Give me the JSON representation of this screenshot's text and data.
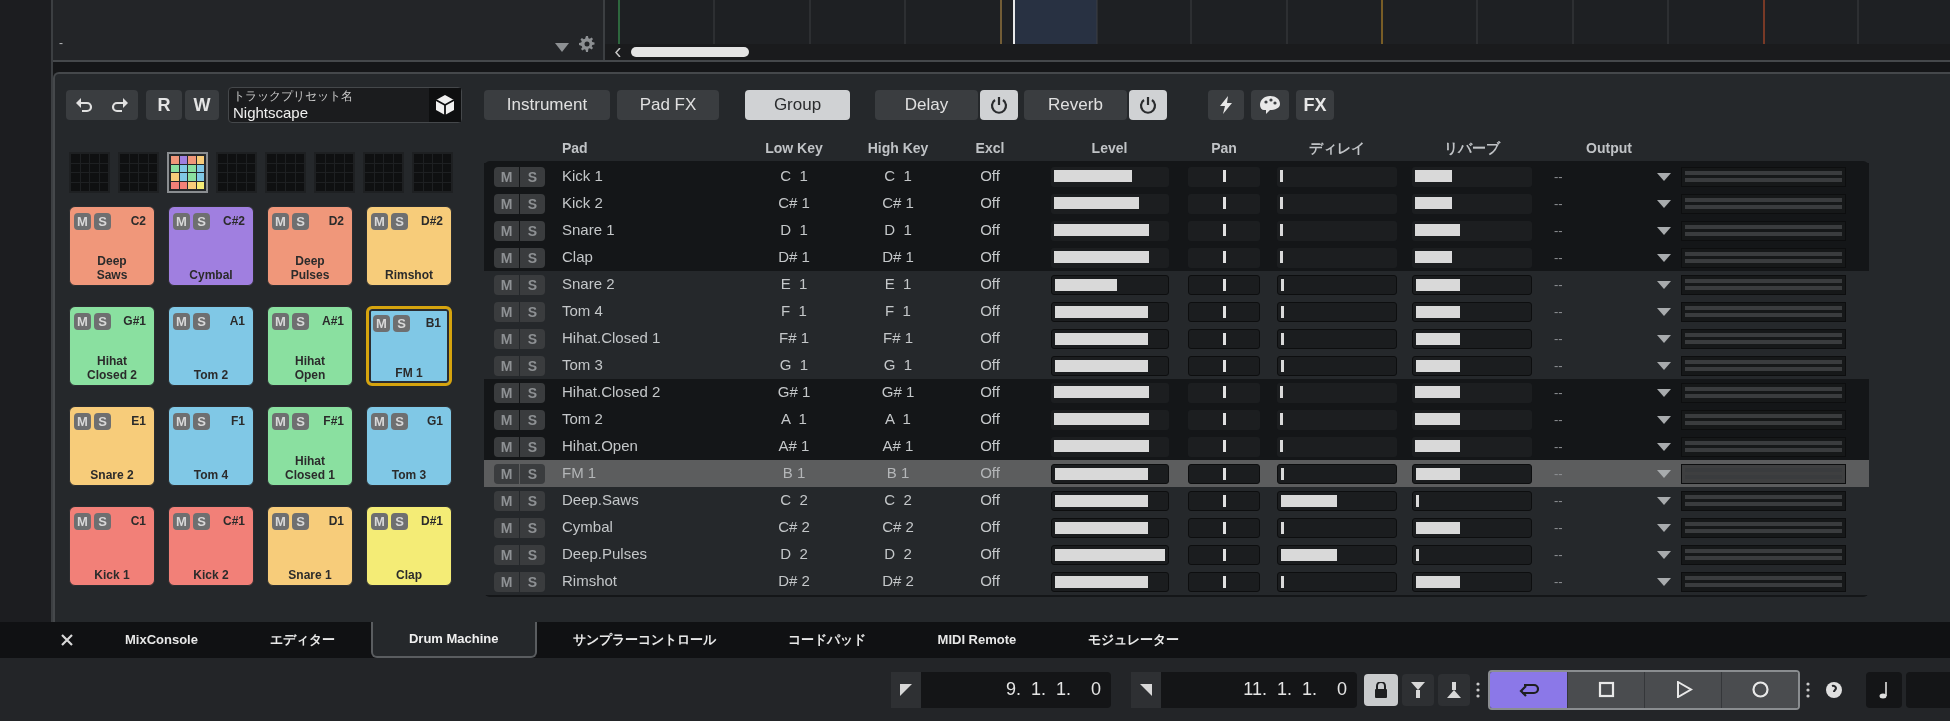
{
  "track_header": {
    "label": "-"
  },
  "toolbar": {
    "record_read": "R",
    "record_write": "W",
    "preset": {
      "label": "トラックプリセット名",
      "value": "Nightscape"
    },
    "tabs": [
      {
        "label": "Instrument",
        "selected": false
      },
      {
        "label": "Pad FX",
        "selected": false
      },
      {
        "label": "Group",
        "selected": true
      }
    ],
    "effects": [
      {
        "label": "Delay",
        "on": true
      },
      {
        "label": "Reverb",
        "on": true
      }
    ],
    "fx": "FX"
  },
  "pad_banks": [
    {
      "selected": false
    },
    {
      "selected": false
    },
    {
      "selected": true
    },
    {
      "selected": false
    },
    {
      "selected": false
    },
    {
      "selected": false
    },
    {
      "selected": false
    },
    {
      "selected": false
    }
  ],
  "pads": [
    {
      "mute": "M",
      "solo": "S",
      "note": "C2",
      "name": "Deep Saws",
      "color": "#f0977a",
      "selected": false
    },
    {
      "mute": "M",
      "solo": "S",
      "note": "C#2",
      "name": "Cymbal",
      "color": "#a07fe0",
      "selected": false
    },
    {
      "mute": "M",
      "solo": "S",
      "note": "D2",
      "name": "Deep Pulses",
      "color": "#f0977a",
      "selected": false
    },
    {
      "mute": "M",
      "solo": "S",
      "note": "D#2",
      "name": "Rimshot",
      "color": "#f7cc7a",
      "selected": false
    },
    {
      "mute": "M",
      "solo": "S",
      "note": "G#1",
      "name": "Hihat Closed 2",
      "color": "#8ae0a0",
      "selected": false
    },
    {
      "mute": "M",
      "solo": "S",
      "note": "A1",
      "name": "Tom 2",
      "color": "#80c8e6",
      "selected": false
    },
    {
      "mute": "M",
      "solo": "S",
      "note": "A#1",
      "name": "Hihat Open",
      "color": "#8ae0a0",
      "selected": false
    },
    {
      "mute": "M",
      "solo": "S",
      "note": "B1",
      "name": "FM 1",
      "color": "#80c8e6",
      "selected": true
    },
    {
      "mute": "M",
      "solo": "S",
      "note": "E1",
      "name": "Snare 2",
      "color": "#f7cc7a",
      "selected": false
    },
    {
      "mute": "M",
      "solo": "S",
      "note": "F1",
      "name": "Tom 4",
      "color": "#80c8e6",
      "selected": false
    },
    {
      "mute": "M",
      "solo": "S",
      "note": "F#1",
      "name": "Hihat Closed 1",
      "color": "#8ae0a0",
      "selected": false
    },
    {
      "mute": "M",
      "solo": "S",
      "note": "G1",
      "name": "Tom 3",
      "color": "#80c8e6",
      "selected": false
    },
    {
      "mute": "M",
      "solo": "S",
      "note": "C1",
      "name": "Kick 1",
      "color": "#f28078",
      "selected": false
    },
    {
      "mute": "M",
      "solo": "S",
      "note": "C#1",
      "name": "Kick 2",
      "color": "#f28078",
      "selected": false
    },
    {
      "mute": "M",
      "solo": "S",
      "note": "D1",
      "name": "Snare 1",
      "color": "#f7cc7a",
      "selected": false
    },
    {
      "mute": "M",
      "solo": "S",
      "note": "D#1",
      "name": "Clap",
      "color": "#f4ec76",
      "selected": false
    }
  ],
  "table": {
    "columns": [
      "Pad",
      "Low Key",
      "High Key",
      "Excl",
      "Level",
      "Pan",
      "ディレイ",
      "リバーブ",
      "Output"
    ],
    "rows": [
      {
        "mute": "M",
        "solo": "S",
        "pad": "Kick 1",
        "low_key": "C  1",
        "high_key": "C  1",
        "excl": "Off",
        "level": {
          "level": 0.7
        },
        "pan": {
          "level": 0.5
        },
        "delay": {
          "level": 0.02
        },
        "reverb": {
          "level": 0.33
        },
        "output": "--",
        "shaded": false,
        "selected": false
      },
      {
        "mute": "M",
        "solo": "S",
        "pad": "Kick 2",
        "low_key": "C# 1",
        "high_key": "C# 1",
        "excl": "Off",
        "level": {
          "level": 0.76
        },
        "pan": {
          "level": 0.5
        },
        "delay": {
          "level": 0.02
        },
        "reverb": {
          "level": 0.33
        },
        "output": "--",
        "shaded": false,
        "selected": false
      },
      {
        "mute": "M",
        "solo": "S",
        "pad": "Snare 1",
        "low_key": "D  1",
        "high_key": "D  1",
        "excl": "Off",
        "level": {
          "level": 0.85
        },
        "pan": {
          "level": 0.5
        },
        "delay": {
          "level": 0.02
        },
        "reverb": {
          "level": 0.4
        },
        "output": "--",
        "shaded": false,
        "selected": false
      },
      {
        "mute": "M",
        "solo": "S",
        "pad": "Clap",
        "low_key": "D# 1",
        "high_key": "D# 1",
        "excl": "Off",
        "level": {
          "level": 0.85
        },
        "pan": {
          "level": 0.5
        },
        "delay": {
          "level": 0.02
        },
        "reverb": {
          "level": 0.33
        },
        "output": "--",
        "shaded": false,
        "selected": false
      },
      {
        "mute": "M",
        "solo": "S",
        "pad": "Snare 2",
        "low_key": "E  1",
        "high_key": "E  1",
        "excl": "Off",
        "level": {
          "level": 0.57
        },
        "pan": {
          "level": 0.5
        },
        "delay": {
          "level": 0.02
        },
        "reverb": {
          "level": 0.4
        },
        "output": "--",
        "shaded": true,
        "selected": false
      },
      {
        "mute": "M",
        "solo": "S",
        "pad": "Tom 4",
        "low_key": "F  1",
        "high_key": "F  1",
        "excl": "Off",
        "level": {
          "level": 0.85
        },
        "pan": {
          "level": 0.5
        },
        "delay": {
          "level": 0.02
        },
        "reverb": {
          "level": 0.4
        },
        "output": "--",
        "shaded": true,
        "selected": false
      },
      {
        "mute": "M",
        "solo": "S",
        "pad": "Hihat.Closed 1",
        "low_key": "F# 1",
        "high_key": "F# 1",
        "excl": "Off",
        "level": {
          "level": 0.85
        },
        "pan": {
          "level": 0.5
        },
        "delay": {
          "level": 0.02
        },
        "reverb": {
          "level": 0.4
        },
        "output": "--",
        "shaded": true,
        "selected": false
      },
      {
        "mute": "M",
        "solo": "S",
        "pad": "Tom 3",
        "low_key": "G  1",
        "high_key": "G  1",
        "excl": "Off",
        "level": {
          "level": 0.85
        },
        "pan": {
          "level": 0.5
        },
        "delay": {
          "level": 0.02
        },
        "reverb": {
          "level": 0.4
        },
        "output": "--",
        "shaded": true,
        "selected": false
      },
      {
        "mute": "M",
        "solo": "S",
        "pad": "Hihat.Closed 2",
        "low_key": "G# 1",
        "high_key": "G# 1",
        "excl": "Off",
        "level": {
          "level": 0.85
        },
        "pan": {
          "level": 0.5
        },
        "delay": {
          "level": 0.02
        },
        "reverb": {
          "level": 0.4
        },
        "output": "--",
        "shaded": false,
        "selected": false
      },
      {
        "mute": "M",
        "solo": "S",
        "pad": "Tom 2",
        "low_key": "A  1",
        "high_key": "A  1",
        "excl": "Off",
        "level": {
          "level": 0.85
        },
        "pan": {
          "level": 0.5
        },
        "delay": {
          "level": 0.02
        },
        "reverb": {
          "level": 0.4
        },
        "output": "--",
        "shaded": false,
        "selected": false
      },
      {
        "mute": "M",
        "solo": "S",
        "pad": "Hihat.Open",
        "low_key": "A# 1",
        "high_key": "A# 1",
        "excl": "Off",
        "level": {
          "level": 0.85
        },
        "pan": {
          "level": 0.5
        },
        "delay": {
          "level": 0.02
        },
        "reverb": {
          "level": 0.4
        },
        "output": "--",
        "shaded": false,
        "selected": false
      },
      {
        "mute": "M",
        "solo": "S",
        "pad": "FM 1",
        "low_key": "B 1",
        "high_key": "B 1",
        "excl": "Off",
        "level": {
          "level": 0.85
        },
        "pan": {
          "level": 0.5
        },
        "delay": {
          "level": 0.02
        },
        "reverb": {
          "level": 0.4
        },
        "output": "--",
        "shaded": true,
        "selected": true
      },
      {
        "mute": "M",
        "solo": "S",
        "pad": "Deep.Saws",
        "low_key": "C  2",
        "high_key": "C  2",
        "excl": "Off",
        "level": {
          "level": 0.85
        },
        "pan": {
          "level": 0.5
        },
        "delay": {
          "level": 0.5
        },
        "reverb": {
          "level": 0.02
        },
        "output": "--",
        "shaded": true,
        "selected": false
      },
      {
        "mute": "M",
        "solo": "S",
        "pad": "Cymbal",
        "low_key": "C# 2",
        "high_key": "C# 2",
        "excl": "Off",
        "level": {
          "level": 0.85
        },
        "pan": {
          "level": 0.5
        },
        "delay": {
          "level": 0.02
        },
        "reverb": {
          "level": 0.4
        },
        "output": "--",
        "shaded": true,
        "selected": false
      },
      {
        "mute": "M",
        "solo": "S",
        "pad": "Deep.Pulses",
        "low_key": "D  2",
        "high_key": "D  2",
        "excl": "Off",
        "level": {
          "level": 1.0
        },
        "pan": {
          "level": 0.5
        },
        "delay": {
          "level": 0.5
        },
        "reverb": {
          "level": 0.02
        },
        "output": "--",
        "shaded": true,
        "selected": false
      },
      {
        "mute": "M",
        "solo": "S",
        "pad": "Rimshot",
        "low_key": "D# 2",
        "high_key": "D# 2",
        "excl": "Off",
        "level": {
          "level": 0.85
        },
        "pan": {
          "level": 0.5
        },
        "delay": {
          "level": 0.02
        },
        "reverb": {
          "level": 0.4
        },
        "output": "--",
        "shaded": true,
        "selected": false
      }
    ]
  },
  "bottom_tabs": [
    {
      "label": "MixConsole",
      "selected": false
    },
    {
      "label": "エディター",
      "selected": false
    },
    {
      "label": "Drum Machine",
      "selected": true
    },
    {
      "label": "サンプラーコントロール",
      "selected": false
    },
    {
      "label": "コードパッド",
      "selected": false
    },
    {
      "label": "MIDI Remote",
      "selected": false
    },
    {
      "label": "モジュレーター",
      "selected": false
    }
  ],
  "transport": {
    "left_locator": "9.  1.  1.    0",
    "right_locator": "11.  1.  1.    0",
    "lock": {
      "on": true
    },
    "buttons": [
      {
        "kind": "cycle",
        "on": true
      },
      {
        "kind": "stop",
        "on": false
      },
      {
        "kind": "play",
        "on": false
      },
      {
        "kind": "record",
        "on": false
      }
    ]
  }
}
